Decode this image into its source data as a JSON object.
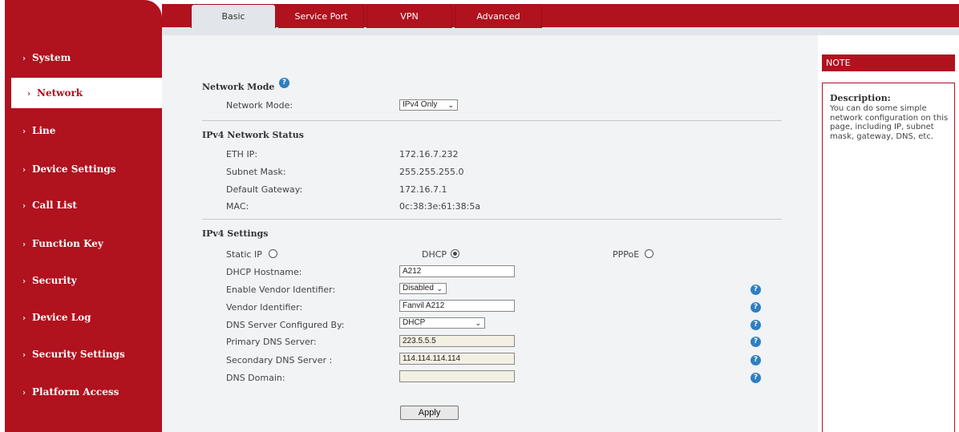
{
  "tabs": [
    {
      "label": "Basic"
    },
    {
      "label": "Service Port"
    },
    {
      "label": "VPN"
    },
    {
      "label": "Advanced"
    }
  ],
  "sidebar": {
    "items": [
      {
        "label": "System"
      },
      {
        "label": "Network"
      },
      {
        "label": "Line"
      },
      {
        "label": "Device Settings"
      },
      {
        "label": "Call List"
      },
      {
        "label": "Function Key"
      },
      {
        "label": "Security"
      },
      {
        "label": "Device Log"
      },
      {
        "label": "Security Settings"
      },
      {
        "label": "Platform Access"
      }
    ],
    "active": "Network",
    "chevron": "›"
  },
  "network_mode": {
    "heading": "Network Mode",
    "label": "Network Mode:",
    "value": "IPv4 Only"
  },
  "ipv4_status": {
    "heading": "IPv4 Network Status",
    "rows": [
      {
        "label": "ETH IP:",
        "value": "172.16.7.232"
      },
      {
        "label": "Subnet Mask:",
        "value": "255.255.255.0"
      },
      {
        "label": "Default Gateway:",
        "value": "172.16.7.1"
      },
      {
        "label": "MAC:",
        "value": "0c:38:3e:61:38:5a"
      }
    ]
  },
  "ipv4_settings": {
    "heading": "IPv4 Settings",
    "modes": [
      {
        "label": "Static IP",
        "checked": false
      },
      {
        "label": "DHCP",
        "checked": true
      },
      {
        "label": "PPPoE",
        "checked": false
      }
    ],
    "fields": {
      "dhcp_hostname": {
        "label": "DHCP Hostname:",
        "value": "A212"
      },
      "enable_vendor": {
        "label": "Enable Vendor Identifier:",
        "value": "Disabled"
      },
      "vendor_identifier": {
        "label": "Vendor Identifier:",
        "value": "Fanvil A212"
      },
      "dns_configured_by": {
        "label": "DNS Server Configured By:",
        "value": "DHCP"
      },
      "primary_dns": {
        "label": "Primary DNS Server:",
        "value": "223.5.5.5"
      },
      "secondary_dns": {
        "label": "Secondary DNS Server :",
        "value": "114.114.114.114"
      },
      "dns_domain": {
        "label": "DNS Domain:",
        "value": ""
      }
    },
    "apply_label": "Apply"
  },
  "note": {
    "header": "NOTE",
    "title": "Description:",
    "text": "You can do some simple network configuration on this page, including IP, subnet mask, gateway, DNS, etc."
  },
  "icons": {
    "help": "question-circle-icon",
    "chevron": "chevron-right-icon",
    "dropdown": "chevron-down-icon"
  },
  "colors": {
    "brand_red": "#b0121e",
    "help_blue": "#2f7fc1",
    "content_bg": "#f1f3f5"
  }
}
